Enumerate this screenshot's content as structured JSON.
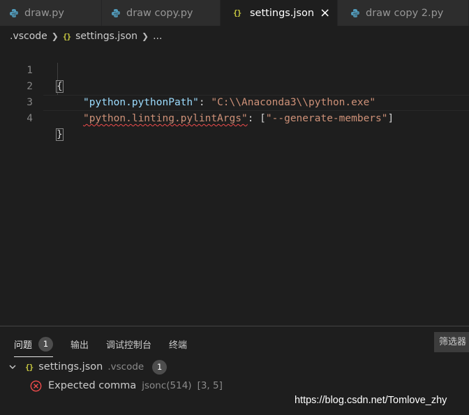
{
  "tabs": [
    {
      "label": "draw.py",
      "icon": "python-icon",
      "active": false
    },
    {
      "label": "draw copy.py",
      "icon": "python-icon",
      "active": false
    },
    {
      "label": "settings.json",
      "icon": "json-icon",
      "active": true
    },
    {
      "label": "draw copy 2.py",
      "icon": "python-icon",
      "active": false
    }
  ],
  "json_icon_glyph": "{}",
  "breadcrumb": {
    "folder": ".vscode",
    "file": "settings.json",
    "more": "..."
  },
  "editor": {
    "line_numbers": [
      "1",
      "2",
      "3",
      "4"
    ],
    "line1": "{",
    "line2_key": "\"python.pythonPath\"",
    "line2_colon": ": ",
    "line2_value": "\"C:\\\\Anaconda3\\\\python.exe\"",
    "line3_key": "\"python.linting.pylintArgs\"",
    "line3_colon": ": ",
    "line3_open": "[",
    "line3_value": "\"--generate-members\"",
    "line3_close": "]",
    "line4": "}"
  },
  "panel": {
    "tabs": [
      {
        "label": "问题",
        "badge": "1",
        "active": true
      },
      {
        "label": "输出"
      },
      {
        "label": "调试控制台"
      },
      {
        "label": "终端"
      }
    ],
    "filter_placeholder": "筛选器",
    "file_group": {
      "file": "settings.json",
      "folder": ".vscode",
      "count": "1"
    },
    "problem": {
      "message": "Expected comma",
      "source": "jsonc(514)",
      "location": "[3, 5]"
    }
  },
  "watermark": "https://blog.csdn.net/Tomlove_zhy",
  "colors": {
    "background": "#1e1e1e",
    "json_key": "#9cdcfe",
    "json_string": "#ce9178",
    "error": "#f14c4c",
    "json_icon": "#cbcb41",
    "python_icon": "#519aba"
  }
}
